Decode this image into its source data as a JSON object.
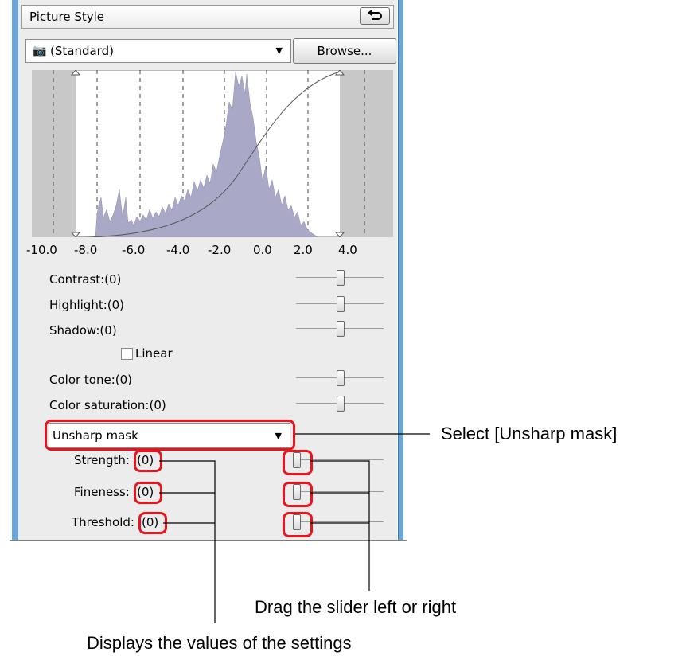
{
  "panel": {
    "title": "Picture Style",
    "style_select": "(Standard)",
    "browse_label": "Browse..."
  },
  "histogram": {
    "ticks": [
      "-10.0",
      "-8.0",
      "-6.0",
      "-4.0",
      "-2.0",
      "0.0",
      "2.0",
      "4.0"
    ]
  },
  "sliders": {
    "contrast": "Contrast:(0)",
    "highlight": "Highlight:(0)",
    "shadow": "Shadow:(0)",
    "linear": "Linear",
    "color_tone": "Color tone:(0)",
    "color_saturation": "Color saturation:(0)"
  },
  "unsharp": {
    "select": "Unsharp mask",
    "strength_label": "Strength:",
    "fineness_label": "Fineness:",
    "threshold_label": "Threshold:",
    "strength_value": "(0)",
    "fineness_value": "(0)",
    "threshold_value": "(0)"
  },
  "annotations": {
    "select": "Select [Unsharp mask]",
    "drag": "Drag the slider left or right",
    "values": "Displays the values of the settings"
  },
  "colors": {
    "highlight_red": "#e8141e",
    "histogram_fill": "#a9a8c7",
    "frame_blue": "#6aa6d8"
  }
}
